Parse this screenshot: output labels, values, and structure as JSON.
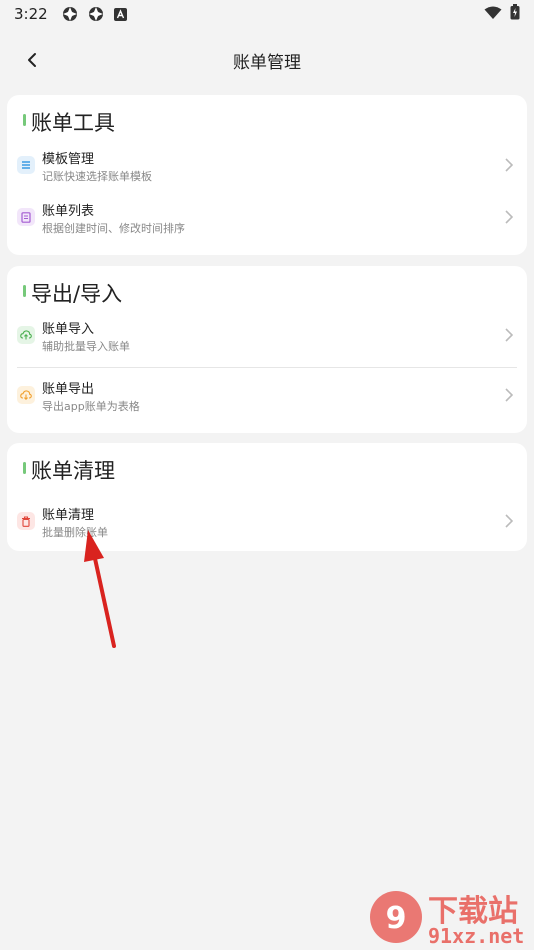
{
  "status_bar": {
    "time": "3:22"
  },
  "header": {
    "title": "账单管理"
  },
  "sections": [
    {
      "title": "账单工具",
      "items": [
        {
          "title": "模板管理",
          "subtitle": "记账快速选择账单模板",
          "icon": "list-icon",
          "color": "#3b9be3"
        },
        {
          "title": "账单列表",
          "subtitle": "根据创建时间、修改时间排序",
          "icon": "document-icon",
          "color": "#a45cd1"
        }
      ]
    },
    {
      "title": "导出/导入",
      "items": [
        {
          "title": "账单导入",
          "subtitle": "辅助批量导入账单",
          "icon": "cloud-upload-icon",
          "color": "#4caf50"
        },
        {
          "title": "账单导出",
          "subtitle": "导出app账单为表格",
          "icon": "cloud-download-icon",
          "color": "#f0a030"
        }
      ]
    },
    {
      "title": "账单清理",
      "items": [
        {
          "title": "账单清理",
          "subtitle": "批量删除账单",
          "icon": "trash-icon",
          "color": "#e0453a"
        }
      ]
    }
  ],
  "watermark": {
    "brand": "下载站",
    "domain": "91xz.net"
  }
}
